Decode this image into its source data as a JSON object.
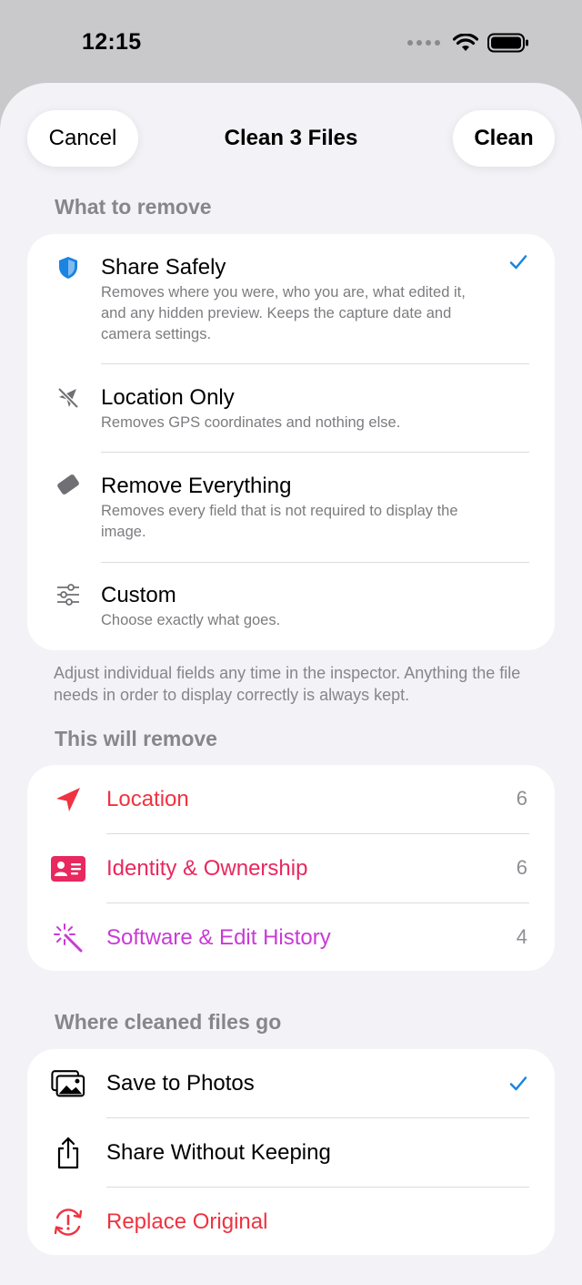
{
  "status_bar": {
    "time": "12:15"
  },
  "sheet": {
    "title": "Clean 3 Files",
    "cancel_label": "Cancel",
    "clean_label": "Clean"
  },
  "what_to_remove": {
    "header": "What to remove",
    "options": [
      {
        "title": "Share Safely",
        "desc": "Removes where you were, who you are, what edited it, and any hidden preview. Keeps the capture date and camera settings.",
        "icon": "shield-icon",
        "selected": true
      },
      {
        "title": "Location Only",
        "desc": "Removes GPS coordinates and nothing else.",
        "icon": "location-slash-icon",
        "selected": false
      },
      {
        "title": "Remove Everything",
        "desc": "Removes every field that is not required to display the image.",
        "icon": "eraser-icon",
        "selected": false
      },
      {
        "title": "Custom",
        "desc": "Choose exactly what goes.",
        "icon": "sliders-icon",
        "selected": false
      }
    ],
    "footnote": "Adjust individual fields any time in the inspector. Anything the file needs in order to display correctly is always kept."
  },
  "this_will_remove": {
    "header": "This will remove",
    "categories": [
      {
        "label": "Location",
        "count": "6",
        "color": "#ef3340",
        "icon": "location-arrow-icon"
      },
      {
        "label": "Identity & Ownership",
        "count": "6",
        "color": "#e8285e",
        "icon": "person-card-icon"
      },
      {
        "label": "Software & Edit History",
        "count": "4",
        "color": "#c93ad6",
        "icon": "magic-wand-icon"
      }
    ]
  },
  "destination": {
    "header": "Where cleaned files go",
    "options": [
      {
        "label": "Save to Photos",
        "icon": "photos-icon",
        "selected": true,
        "color": "#000000"
      },
      {
        "label": "Share Without Keeping",
        "icon": "share-icon",
        "selected": false,
        "color": "#000000"
      },
      {
        "label": "Replace Original",
        "icon": "replace-icon",
        "selected": false,
        "color": "#ef3340"
      }
    ]
  },
  "colors": {
    "accent": "#1a84e0",
    "background": "#f2f2f7",
    "card": "#ffffff"
  }
}
